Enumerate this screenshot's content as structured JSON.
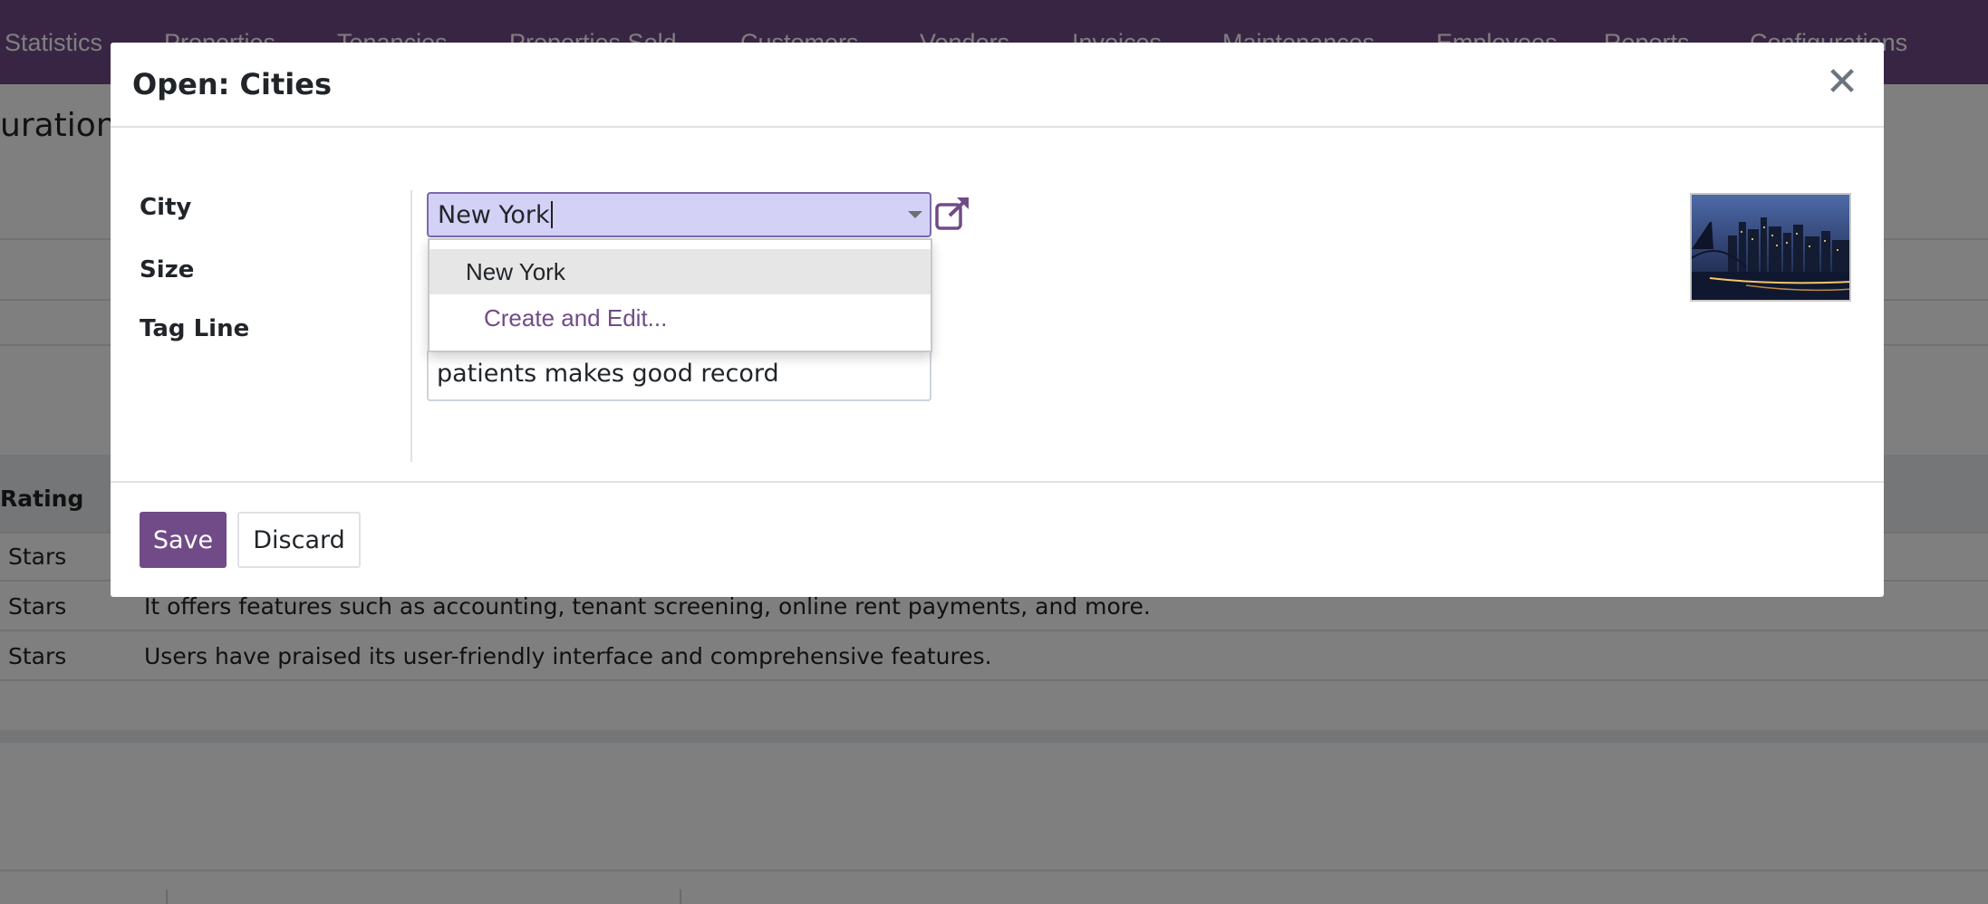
{
  "top_nav": {
    "items": [
      "Statistics",
      "Properties",
      "Tenancies",
      "Properties Sold",
      "Customers",
      "Vendors",
      "Invoices",
      "Maintenances",
      "Employees",
      "Reports",
      "Configurations"
    ]
  },
  "page": {
    "heading": "uration",
    "table_header_rating": "Rating",
    "rows": [
      {
        "stars": "Stars",
        "text": ""
      },
      {
        "stars": "Stars",
        "text": "It offers features such as accounting, tenant screening, online rent payments, and more."
      },
      {
        "stars": "Stars",
        "text": "Users have praised its user-friendly interface and comprehensive features."
      }
    ]
  },
  "modal": {
    "title": "Open: Cities",
    "close_icon": "close-icon",
    "fields": {
      "city_label": "City",
      "size_label": "Size",
      "tag_line_label": "Tag Line"
    },
    "city_value": "New York",
    "tag_line_value": "patients makes good record",
    "autocomplete": {
      "options": [
        "New York"
      ],
      "create_label": "Create and Edit..."
    },
    "external_link_icon": "external-link-icon",
    "image_icon": "city-skyline-image",
    "save_label": "Save",
    "discard_label": "Discard"
  },
  "colors": {
    "brand": "#714b87",
    "input_focus_bg": "#d3d1f6"
  }
}
